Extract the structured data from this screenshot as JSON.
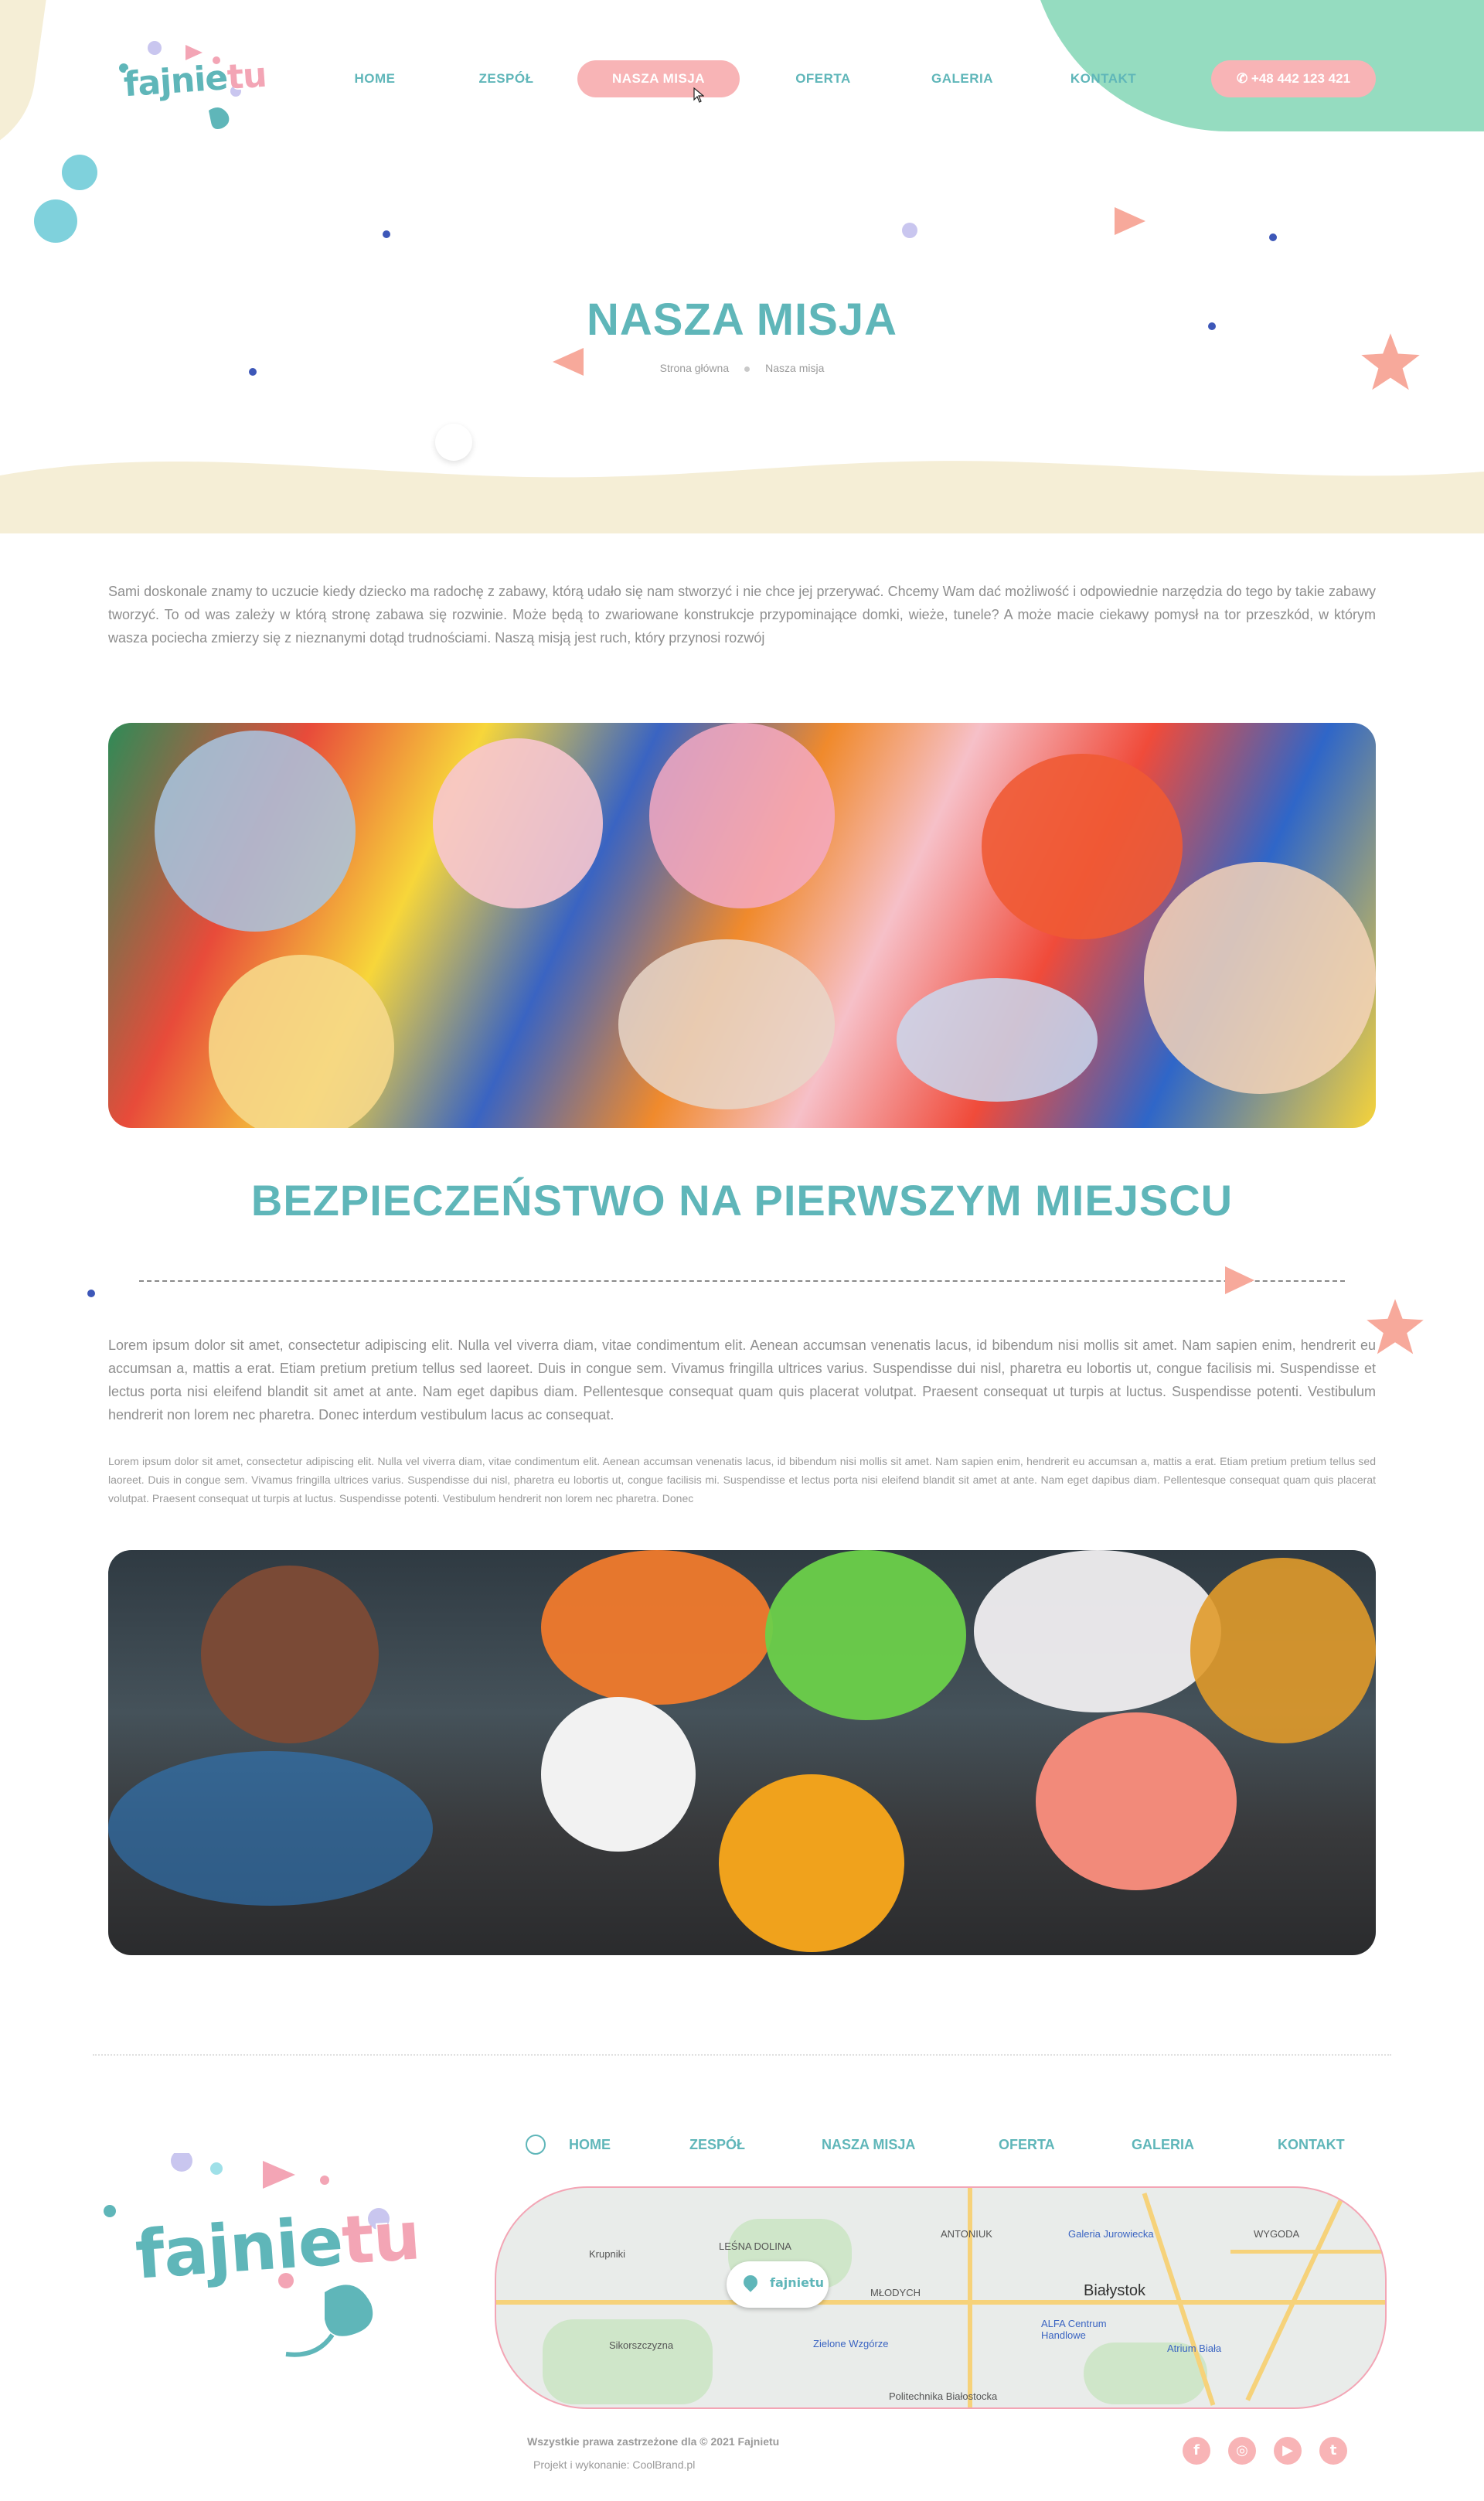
{
  "brand": {
    "logo_part1": "fajnie",
    "logo_part2": "tu"
  },
  "nav": {
    "items": [
      {
        "label": "HOME"
      },
      {
        "label": "ZESPÓŁ"
      },
      {
        "label": "NASZA MISJA"
      },
      {
        "label": "OFERTA"
      },
      {
        "label": "GALERIA"
      },
      {
        "label": "KONTAKT"
      }
    ],
    "active": "NASZA MISJA",
    "phone": "+48 442 123 421"
  },
  "hero": {
    "title": "NASZA MISJA",
    "breadcrumb": [
      "Strona główna",
      "Nasza misja"
    ]
  },
  "content": {
    "intro": "Sami doskonale znamy to uczucie kiedy dziecko ma radochę z zabawy, którą udało się nam stworzyć i nie chce jej przerywać. Chcemy Wam dać możliwość i odpowiednie narzędzia do tego by takie zabawy tworzyć. To od was zależy w którą stronę zabawa się rozwinie. Może będą to zwariowane konstrukcje przypominające domki, wieże, tunele? A może macie ciekawy pomysł na tor przeszkód, w którym wasza pociecha zmierzy się z nieznanymi dotąd trudnościami. Naszą misją jest ruch, który przynosi rozwój",
    "section_title": "BEZPIECZEŃSTWO NA PIERWSZYM MIEJSCU",
    "paragraph1": "Lorem ipsum dolor sit amet, consectetur adipiscing elit. Nulla vel viverra diam, vitae condimentum elit. Aenean accumsan venenatis lacus, id bibendum nisi mollis sit amet. Nam sapien enim, hendrerit eu accumsan a, mattis a erat. Etiam pretium pretium tellus sed laoreet. Duis in congue sem. Vivamus fringilla ultrices varius. Suspendisse dui nisl, pharetra eu lobortis ut, congue facilisis mi. Suspendisse et lectus porta nisi eleifend blandit sit amet at ante. Nam eget dapibus diam. Pellentesque consequat quam quis placerat volutpat. Praesent consequat ut turpis at luctus. Suspendisse potenti. Vestibulum hendrerit non lorem nec pharetra. Donec interdum vestibulum lacus ac consequat.",
    "paragraph2": "Lorem ipsum dolor sit amet, consectetur adipiscing elit. Nulla vel viverra diam, vitae condimentum elit. Aenean accumsan venenatis lacus, id bibendum nisi mollis sit amet. Nam sapien enim, hendrerit eu accumsan a, mattis a erat. Etiam pretium pretium tellus sed laoreet. Duis in congue sem. Vivamus fringilla ultrices varius. Suspendisse dui nisl, pharetra eu lobortis ut, congue facilisis mi. Suspendisse et lectus porta nisi eleifend blandit sit amet at ante. Nam eget dapibus diam. Pellentesque consequat quam quis placerat volutpat. Praesent consequat ut turpis at luctus. Suspendisse potenti. Vestibulum hendrerit non lorem nec pharetra. Donec"
  },
  "footer": {
    "menu": [
      {
        "label": "HOME"
      },
      {
        "label": "ZESPÓŁ"
      },
      {
        "label": "NASZA MISJA"
      },
      {
        "label": "OFERTA"
      },
      {
        "label": "GALERIA"
      },
      {
        "label": "KONTAKT"
      }
    ],
    "map_labels": {
      "krupniki": "Krupniki",
      "lesna_dolina": "LEŚNA DOLINA",
      "antoniuk": "ANTONIUK",
      "galeria": "Galeria Jurowiecka",
      "wygoda": "WYGODA",
      "mlodych": "MŁODYCH",
      "bialystok": "Białystok",
      "alfa": "ALFA Centrum Handlowe",
      "atrium": "Atrium Biała",
      "sikorszczyzna": "Sikorszczyzna",
      "zielone": "Zielone Wzgórze",
      "politechnika": "Politechnika Białostocka"
    },
    "copyright": "Wszystkie prawa zastrzeżone dla © 2021 Fajnietu",
    "credits": "Projekt i wykonanie: CoolBrand.pl",
    "social": [
      "facebook",
      "instagram",
      "youtube",
      "twitter"
    ],
    "social_glyphs": [
      "f",
      "◎",
      "▶",
      "t"
    ]
  },
  "colors": {
    "teal": "#5fb6b9",
    "pink": "#f8b4b6",
    "mint": "#95dcc0",
    "cream": "#f5eed6"
  }
}
